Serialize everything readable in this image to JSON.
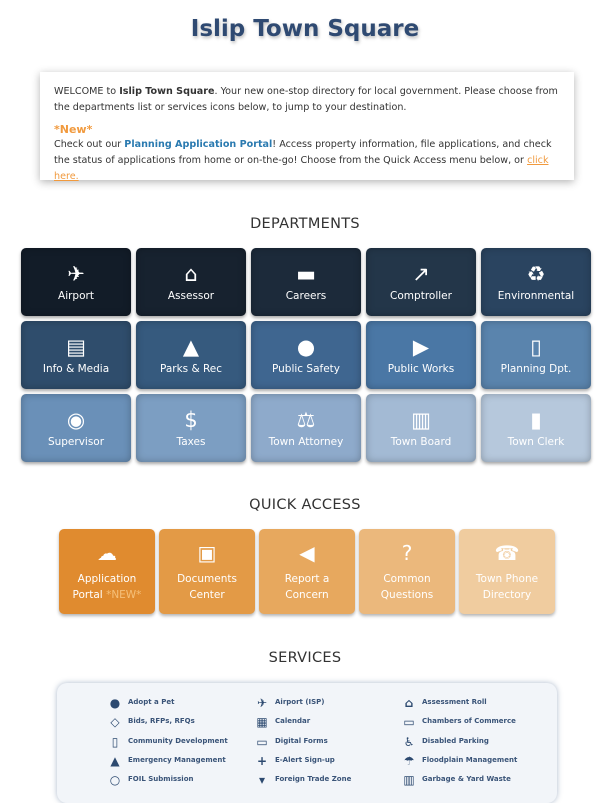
{
  "header": {
    "title": "Islip Town Square"
  },
  "welcome": {
    "p1_a": "WELCOME to ",
    "p1_bold": "Islip Town Square",
    "p1_b": ". Your new one-stop directory for local government. Please choose from the departments list or services icons below, to jump to your destination.",
    "new_label": "*New*",
    "p2_a": "Check out our ",
    "p2_link": "Planning Application Portal",
    "p2_b": "! Access property information, file applications, and check the status of applications from home or on-the-go! Choose from the Quick Access menu below, or ",
    "p2_click": "click here."
  },
  "departments": {
    "heading": "DEPARTMENTS",
    "items": [
      {
        "label": "Airport",
        "icon": "plane",
        "color": "#121c28"
      },
      {
        "label": "Assessor",
        "icon": "home",
        "color": "#17222f"
      },
      {
        "label": "Careers",
        "icon": "briefcase",
        "color": "#1c2a3a"
      },
      {
        "label": "Comptroller",
        "icon": "chart-line",
        "color": "#233649"
      },
      {
        "label": "Environmental",
        "icon": "recycle",
        "color": "#2a4460"
      },
      {
        "label": "Info & Media",
        "icon": "newspaper",
        "color": "#2f4d6c"
      },
      {
        "label": "Parks & Rec",
        "icon": "tree",
        "color": "#365a7e"
      },
      {
        "label": "Public Safety",
        "icon": "users",
        "color": "#3f6690"
      },
      {
        "label": "Public Works",
        "icon": "truck",
        "color": "#4a77a5"
      },
      {
        "label": "Planning Dpt.",
        "icon": "map",
        "color": "#5a84ad"
      },
      {
        "label": "Supervisor",
        "icon": "user-circle",
        "color": "#6a90b8"
      },
      {
        "label": "Taxes",
        "icon": "dollar",
        "color": "#7c9ec2"
      },
      {
        "label": "Town Attorney",
        "icon": "balance-scale",
        "color": "#8eaacb"
      },
      {
        "label": "Town Board",
        "icon": "institution",
        "color": "#a3bad4"
      },
      {
        "label": "Town Clerk",
        "icon": "book",
        "color": "#b6c8dc"
      }
    ]
  },
  "quick_access": {
    "heading": "QUICK ACCESS",
    "items": [
      {
        "line1": "Application",
        "line2": "Portal ",
        "tag": "*NEW*",
        "icon": "cloud-upload",
        "color": "#e08b2f"
      },
      {
        "line1": "Documents",
        "line2": "Center",
        "icon": "archive",
        "color": "#e39a46"
      },
      {
        "line1": "Report a",
        "line2": "Concern",
        "icon": "bullhorn",
        "color": "#e7a85e"
      },
      {
        "line1": "Common",
        "line2": "Questions",
        "icon": "question",
        "color": "#ebb87c"
      },
      {
        "line1": "Town Phone",
        "line2": "Directory",
        "icon": "phone",
        "color": "#f0cc9f"
      }
    ]
  },
  "services": {
    "heading": "SERVICES",
    "items": [
      {
        "label": "Adopt a Pet",
        "icon": "paw"
      },
      {
        "label": "Airport (ISP)",
        "icon": "plane"
      },
      {
        "label": "Assessment Roll",
        "icon": "home"
      },
      {
        "label": "Bids, RFPs, RFQs",
        "icon": "handshake"
      },
      {
        "label": "Calendar",
        "icon": "calendar"
      },
      {
        "label": "Chambers of Commerce",
        "icon": "shopping-basket"
      },
      {
        "label": "Community Development",
        "icon": "building"
      },
      {
        "label": "Digital Forms",
        "icon": "laptop"
      },
      {
        "label": "Disabled Parking",
        "icon": "wheelchair"
      },
      {
        "label": "Emergency Management",
        "icon": "warning"
      },
      {
        "label": "E-Alert Sign-up",
        "icon": "user-plus"
      },
      {
        "label": "Floodplain Management",
        "icon": "umbrella"
      },
      {
        "label": "FOIL Submission",
        "icon": "life-ring"
      },
      {
        "label": "Foreign Trade Zone",
        "icon": "ship"
      },
      {
        "label": "Garbage & Yard Waste",
        "icon": "trash"
      }
    ]
  }
}
